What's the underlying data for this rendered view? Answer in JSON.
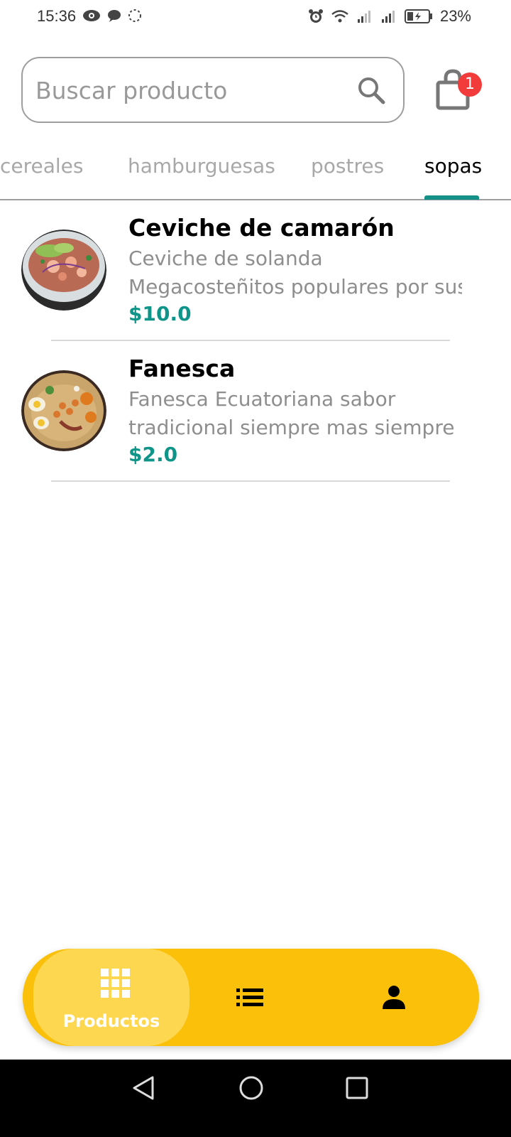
{
  "status_bar": {
    "time": "15:36",
    "battery": "23%",
    "icons": [
      "eye-icon",
      "chat-icon",
      "loading-icon",
      "alarm-icon",
      "wifi-icon",
      "signal-icon",
      "signal-icon",
      "battery-icon"
    ]
  },
  "search": {
    "placeholder": "Buscar producto",
    "value": ""
  },
  "cart": {
    "badge_count": "1",
    "icon": "shopping-bag-icon"
  },
  "tabs": [
    {
      "label": "cereales",
      "active": false
    },
    {
      "label": "hamburguesas",
      "active": false
    },
    {
      "label": "postres",
      "active": false
    },
    {
      "label": "sopas",
      "active": true
    }
  ],
  "products": [
    {
      "name": "Ceviche de camarón",
      "description_line1": "Ceviche de solanda",
      "description_line2": "Megacosteñitos populares por sus",
      "price": "$10.0"
    },
    {
      "name": "Fanesca",
      "description_line1": "Fanesca Ecuatoriana sabor",
      "description_line2": "tradicional siempre mas siempre",
      "price": "$2.0"
    }
  ],
  "bottom_nav": {
    "items": [
      {
        "label": "Productos",
        "icon": "grid-icon",
        "active": true
      },
      {
        "label": "",
        "icon": "list-icon",
        "active": false
      },
      {
        "label": "",
        "icon": "person-icon",
        "active": false
      }
    ]
  },
  "colors": {
    "accent": "#129188",
    "price": "#0e9488",
    "nav_bg": "#fbc00a",
    "nav_active": "#fdd750",
    "badge": "#f23c3c"
  }
}
